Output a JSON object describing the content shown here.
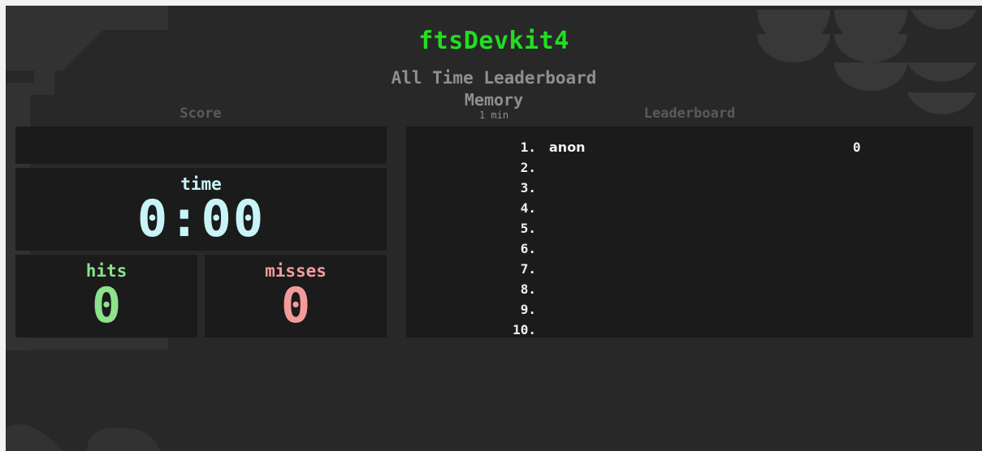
{
  "header": {
    "title": "ftsDevkit4",
    "subtitle": "All Time Leaderboard",
    "game": "Memory",
    "duration": "1 min"
  },
  "labels": {
    "score_section": "Score",
    "leaderboard_section": "Leaderboard"
  },
  "stats": {
    "time_label": "time",
    "time_value": "0:00",
    "hits_label": "hits",
    "hits_value": "0",
    "misses_label": "misses",
    "misses_value": "0"
  },
  "leaderboard": [
    {
      "rank": "1.",
      "name": "anon",
      "score": "0"
    },
    {
      "rank": "2.",
      "name": "",
      "score": ""
    },
    {
      "rank": "3.",
      "name": "",
      "score": ""
    },
    {
      "rank": "4.",
      "name": "",
      "score": ""
    },
    {
      "rank": "5.",
      "name": "",
      "score": ""
    },
    {
      "rank": "6.",
      "name": "",
      "score": ""
    },
    {
      "rank": "7.",
      "name": "",
      "score": ""
    },
    {
      "rank": "8.",
      "name": "",
      "score": ""
    },
    {
      "rank": "9.",
      "name": "",
      "score": ""
    },
    {
      "rank": "10.",
      "name": "",
      "score": ""
    }
  ],
  "colors": {
    "title": "#22dd22",
    "time": "#c8f4f7",
    "hits": "#8de28b",
    "misses": "#f39b9b",
    "background": "#282828",
    "panel": "#1b1b1b"
  }
}
